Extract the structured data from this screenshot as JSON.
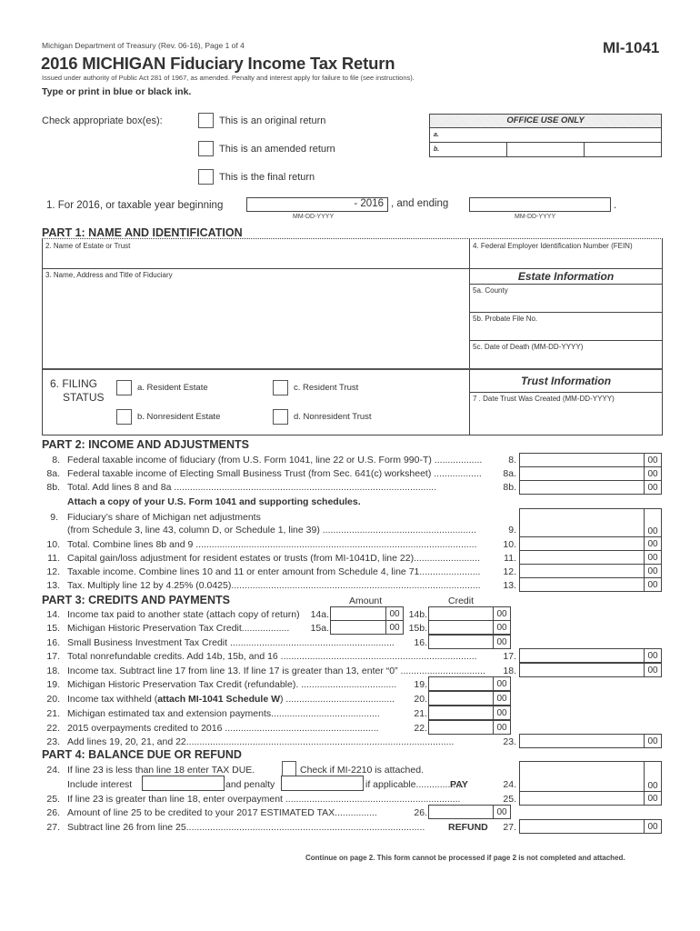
{
  "header": {
    "department": "Michigan Department of Treasury (Rev. 06-16), Page 1 of 4",
    "form_id": "MI-1041",
    "title": "2016 MICHIGAN Fiduciary Income Tax Return",
    "authority": "Issued under authority of Public Act 281 of 1967, as amended.  Penalty and interest apply for failure to file (see instructions).",
    "ink_note": "Type or print in blue or black ink."
  },
  "return_type": {
    "label": "Check appropriate box(es):",
    "options": [
      "This is an original return",
      "This is an amended return",
      "This is the final return"
    ]
  },
  "office_use": {
    "title": "OFFICE USE ONLY",
    "row_a": "a.",
    "row_b": "b."
  },
  "line1": {
    "label": "1.  For 2016, or taxable year beginning",
    "begin_value": "- 2016",
    "connector": ", and ending",
    "end_value": "",
    "format_hint": "MM-DD-YYYY",
    "period": "."
  },
  "part1": {
    "title": "PART 1:  NAME AND IDENTIFICATION",
    "name_label": "2. Name of Estate or Trust",
    "fein_label": "4. Federal Employer Identification Number (FEIN)",
    "fiduciary_label": "3. Name, Address and Title of Fiduciary",
    "estate_info_title": "Estate Information",
    "county_label": "5a. County",
    "probate_label": "5b. Probate File No.",
    "death_label": "5c. Date of Death (MM-DD-YYYY)",
    "filing_status_label_1": "6.  FILING",
    "filing_status_label_2": "STATUS",
    "filing_options": [
      "a.  Resident Estate",
      "b.  Nonresident Estate",
      "c.  Resident Trust",
      "d.  Nonresident Trust"
    ],
    "trust_info_title": "Trust Information",
    "trust_date_label": "7 .  Date Trust Was Created (MM-DD-YYYY)"
  },
  "part2": {
    "title": "PART 2:  INCOME AND ADJUSTMENTS",
    "lines": [
      {
        "no": "8.",
        "text": "Federal taxable income of fiduciary (from U.S. Form 1041, line 22 or U.S. Form 990-T) ..................",
        "ref": "8.",
        "cents": "00"
      },
      {
        "no": "8a.",
        "text": "Federal taxable income of Electing Small Business Trust (from Sec. 641(c) worksheet) ..................",
        "ref": "8a.",
        "cents": "00"
      },
      {
        "no": "8b.",
        "text": "Total. Add lines 8 and 8a ...................................................................................................",
        "ref": "8b.",
        "cents": "00"
      }
    ],
    "attach_note": "Attach a copy of your U.S. Form 1041 and supporting schedules.",
    "line9_no": "9.",
    "line9_text_1": "Fiduciary’s share of Michigan net adjustments",
    "line9_text_2": "(from Schedule 3, line 43, column D, or Schedule 1, line 39) ..........................................................",
    "line9_ref": "9.",
    "line9_cents": "00",
    "lines2": [
      {
        "no": "10.",
        "text": "Total. Combine lines 8b and 9 ..........................................................................................................",
        "ref": "10.",
        "cents": "00"
      },
      {
        "no": "11.",
        "text": "Capital gain/loss adjustment for resident estates or trusts (from MI-1041D, line 22).........................",
        "ref": "11.",
        "cents": "00"
      },
      {
        "no": "12.",
        "text": "Taxable income. Combine lines 10 and 11 or enter amount from Schedule 4, line 71.......................",
        "ref": "12.",
        "cents": "00"
      },
      {
        "no": "13.",
        "text": "Tax. Multiply line 12 by 4.25% (0.0425)..............................................................................................",
        "ref": "13.",
        "cents": "00"
      }
    ]
  },
  "part3": {
    "title": "PART 3:  CREDITS AND PAYMENTS",
    "amount_header": "Amount",
    "credit_header": "Credit",
    "line14": {
      "no": "14.",
      "text": "Income tax paid to another state (attach copy of return)",
      "ref_a": "14a.",
      "ref_b": "14b.",
      "cents": "00"
    },
    "line15": {
      "no": "15.",
      "text": "Michigan Historic Preservation Tax Credit..................",
      "ref_a": "15a.",
      "ref_b": "15b.",
      "cents": "00"
    },
    "line16": {
      "no": "16.",
      "text": "Small Business Investment Tax Credit ..............................................................",
      "ref": "16.",
      "cents": "00"
    },
    "line17": {
      "no": "17.",
      "text": "Total nonrefundable credits.  Add 14b, 15b, and 16 ..........................................................................",
      "ref": "17.",
      "cents": "00"
    },
    "line18": {
      "no": "18.",
      "text": "Income tax. Subtract line 17 from line 13. If line 17 is greater than 13, enter “0” ................................",
      "ref": "18.",
      "cents": "00"
    },
    "mid_lines": [
      {
        "no": "19.",
        "text": "Michigan Historic Preservation Tax Credit (refundable). ....................................",
        "ref": "19.",
        "cents": "00"
      },
      {
        "no": "20.",
        "text_pre": "Income tax withheld (",
        "text_bold": "attach MI-1041 Schedule W",
        "text_post": ") .........................................",
        "ref": "20.",
        "cents": "00"
      },
      {
        "no": "21.",
        "text": "Michigan estimated tax and extension payments.........................................",
        "ref": "21.",
        "cents": "00"
      },
      {
        "no": "22.",
        "text": "2015 overpayments credited to 2016 ..........................................................",
        "ref": "22.",
        "cents": "00"
      }
    ],
    "line23": {
      "no": "23.",
      "text": "Add lines 19, 20, 21, and 22.....................................................................................................",
      "ref": "23.",
      "cents": "00"
    }
  },
  "part4": {
    "title": "PART 4:  BALANCE DUE OR REFUND",
    "line24": {
      "no": "24.",
      "text": "If line 23 is less than line 18 enter TAX DUE.",
      "mi2210_label": "Check if MI-2210 is attached.",
      "interest_label": "Include interest",
      "penalty_label": "and penalty",
      "applicable_label": "if applicable..................",
      "pay_label": "PAY",
      "ref": "24.",
      "cents": "00"
    },
    "line25": {
      "no": "25.",
      "text": "If line 23 is greater than line 18, enter overpayment ..................................................................",
      "ref": "25.",
      "cents": "00"
    },
    "line26": {
      "no": "26.",
      "text": "Amount of line 25 to be credited to your 2017 ESTIMATED TAX................",
      "ref": "26.",
      "cents": "00"
    },
    "line27": {
      "no": "27.",
      "text": "Subtract line 26 from line 25..........................................................................................",
      "refund_label": "REFUND",
      "ref": "27.",
      "cents": "00"
    }
  },
  "footer": {
    "continue_note": "Continue on page 2. This form cannot be processed if page 2 is not completed and attached."
  }
}
